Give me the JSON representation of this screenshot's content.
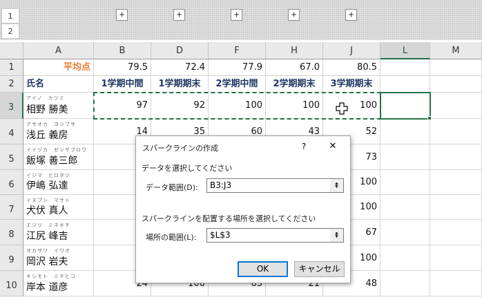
{
  "outline": {
    "levels": [
      "1",
      "2"
    ],
    "expand_symbol": "+"
  },
  "columns": [
    "A",
    "B",
    "D",
    "F",
    "H",
    "J",
    "L",
    "M"
  ],
  "rows": [
    {
      "num": "1",
      "a": "平均点",
      "b": "79.5",
      "d": "72.4",
      "f": "77.9",
      "h": "67.0",
      "j": "80.5"
    },
    {
      "num": "2",
      "a": "氏名",
      "b": "1学期中間",
      "d": "1学期期末",
      "f": "2学期中間",
      "h": "2学期期末",
      "j": "3学期期末"
    },
    {
      "num": "3",
      "furi": "アイノ　カツミ",
      "name": "相野 勝美",
      "b": "97",
      "d": "92",
      "f": "100",
      "h": "100",
      "j": "100"
    },
    {
      "num": "4",
      "furi": "アサオカ　ヨシフサ",
      "name": "浅丘 義房",
      "b": "14",
      "d": "35",
      "f": "60",
      "h": "43",
      "j": "52"
    },
    {
      "num": "5",
      "furi": "イイヅカ　ゼンザブロウ",
      "name": "飯塚 善三郎",
      "j": "73"
    },
    {
      "num": "6",
      "furi": "イジマ　ヒロタツ",
      "name": "伊嶋 弘達",
      "j": "100"
    },
    {
      "num": "7",
      "furi": "イヌブシ　マサト",
      "name": "犬伏 真人",
      "j": "100"
    },
    {
      "num": "8",
      "furi": "エジリ　ミネキチ",
      "name": "江尻 峰吉",
      "j": "67"
    },
    {
      "num": "9",
      "furi": "オカザワ　イワオ",
      "name": "岡沢 岩夫",
      "j": "100"
    },
    {
      "num": "10",
      "furi": "キシモト　ミチヒコ",
      "name": "岸本 道彦",
      "b": "24",
      "d": "100",
      "f": "63",
      "h": "21",
      "j": "48"
    }
  ],
  "dialog": {
    "title": "スパークラインの作成",
    "help": "?",
    "close": "✕",
    "section1": "データを選択してください",
    "data_range_label": "データ範囲(D):",
    "data_range_value": "B3:J3",
    "section2": "スパークラインを配置する場所を選択してください",
    "location_label": "場所の範囲(L):",
    "location_value": "$L$3",
    "collapse_symbol": "⇞",
    "ok": "OK",
    "cancel": "キャンセル"
  },
  "colors": {
    "accent_green": "#217346",
    "header_text": "#1f3864",
    "orange": "#ed7d31"
  }
}
